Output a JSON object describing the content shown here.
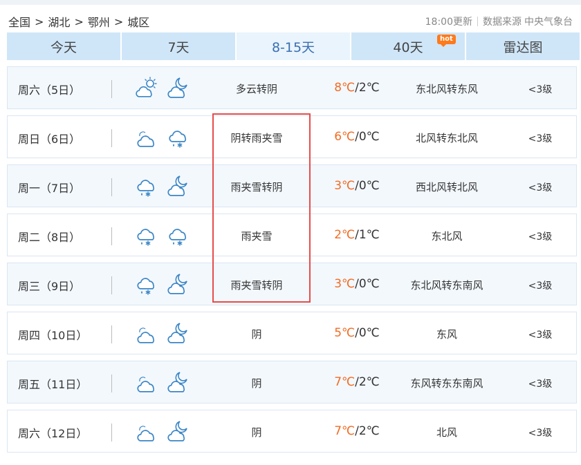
{
  "breadcrumb": {
    "items": [
      "全国",
      "湖北",
      "鄂州",
      "城区"
    ],
    "separator": ">"
  },
  "meta": {
    "update_time": "18:00更新",
    "source_label": "数据来源",
    "source_name": "中央气象台"
  },
  "tabs": [
    {
      "label": "今天",
      "active": false
    },
    {
      "label": "7天",
      "active": false
    },
    {
      "label": "8-15天",
      "active": true
    },
    {
      "label": "40天",
      "active": false,
      "badge": "hot"
    },
    {
      "label": "雷达图",
      "active": false
    }
  ],
  "forecast": [
    {
      "day": "周六（5日）",
      "icon_day": "partly-cloudy-sun-icon",
      "icon_night": "cloudy-moon-icon",
      "condition": "多云转阴",
      "high": "8℃",
      "low": "2℃",
      "wind": "东北风转东风",
      "level": "<3级"
    },
    {
      "day": "周日（6日）",
      "icon_day": "overcast-icon",
      "icon_night": "sleet-icon",
      "condition": "阴转雨夹雪",
      "high": "6℃",
      "low": "0℃",
      "wind": "北风转东北风",
      "level": "<3级"
    },
    {
      "day": "周一（7日）",
      "icon_day": "sleet-icon",
      "icon_night": "cloudy-moon-icon",
      "condition": "雨夹雪转阴",
      "high": "3℃",
      "low": "0℃",
      "wind": "西北风转北风",
      "level": "<3级"
    },
    {
      "day": "周二（8日）",
      "icon_day": "sleet-icon",
      "icon_night": "sleet-icon",
      "condition": "雨夹雪",
      "high": "2℃",
      "low": "1℃",
      "wind": "东北风",
      "level": "<3级"
    },
    {
      "day": "周三（9日）",
      "icon_day": "sleet-icon",
      "icon_night": "cloudy-moon-icon",
      "condition": "雨夹雪转阴",
      "high": "3℃",
      "low": "0℃",
      "wind": "东北风转东南风",
      "level": "<3级"
    },
    {
      "day": "周四（10日）",
      "icon_day": "overcast-icon",
      "icon_night": "cloudy-moon-icon",
      "condition": "阴",
      "high": "5℃",
      "low": "0℃",
      "wind": "东风",
      "level": "<3级"
    },
    {
      "day": "周五（11日）",
      "icon_day": "overcast-icon",
      "icon_night": "cloudy-moon-icon",
      "condition": "阴",
      "high": "7℃",
      "low": "2℃",
      "wind": "东风转东东南风",
      "level": "<3级"
    },
    {
      "day": "周六（12日）",
      "icon_day": "overcast-icon",
      "icon_night": "cloudy-moon-icon",
      "condition": "阴",
      "high": "7℃",
      "low": "2℃",
      "wind": "北风",
      "level": "<3级"
    }
  ],
  "colors": {
    "accent": "#3a6fb0",
    "tab_bg": "#cfe6f8",
    "temp_high": "#f26b22",
    "highlight": "#e84b4b",
    "icon": "#3b86c6"
  }
}
